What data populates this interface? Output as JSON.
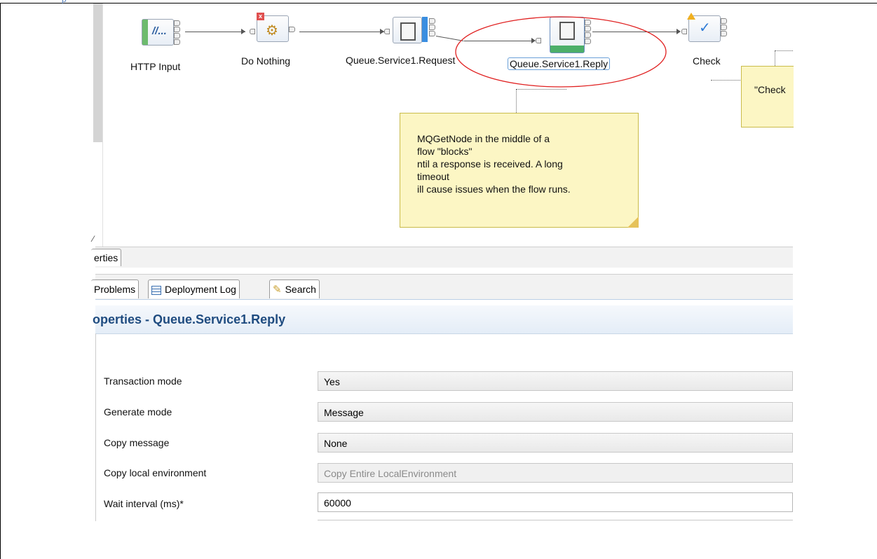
{
  "top_fragment": "p",
  "flow": {
    "nodes": [
      {
        "label": "HTTP Input",
        "glyph": "//...",
        "icon": "http-input-icon"
      },
      {
        "label": "Do Nothing",
        "icon": "compute-gears-icon"
      },
      {
        "label": "Queue.Service1.Request",
        "icon": "mq-request-icon"
      },
      {
        "label": "Queue.Service1.Reply",
        "icon": "mq-get-icon"
      },
      {
        "label": "Check",
        "icon": "validate-check-icon"
      }
    ],
    "notes": {
      "main": [
        "MQGetNode in the middle of a",
        "flow \"blocks\"",
        "ntil a response is received. A long",
        "timeout",
        "ill cause issues when the flow runs."
      ],
      "partial": "\"Check"
    },
    "highlight_color": "#e02020"
  },
  "tabs_top": [
    {
      "label": "erties"
    }
  ],
  "tabs_bottom": [
    {
      "label": "Problems",
      "icon": "problems-icon"
    },
    {
      "label": "Deployment Log",
      "icon": "table-icon"
    },
    {
      "label": "Search",
      "icon": "search-flashlight-icon"
    }
  ],
  "properties": {
    "title": "operties - Queue.Service1.Reply",
    "rows": [
      {
        "label": "Transaction mode",
        "value": "Yes"
      },
      {
        "label": "Generate mode",
        "value": "Message"
      },
      {
        "label": "Copy message",
        "value": "None"
      },
      {
        "label": "Copy local environment",
        "value": "Copy Entire LocalEnvironment"
      },
      {
        "label": "Wait interval (ms)*",
        "value": "60000"
      }
    ]
  }
}
